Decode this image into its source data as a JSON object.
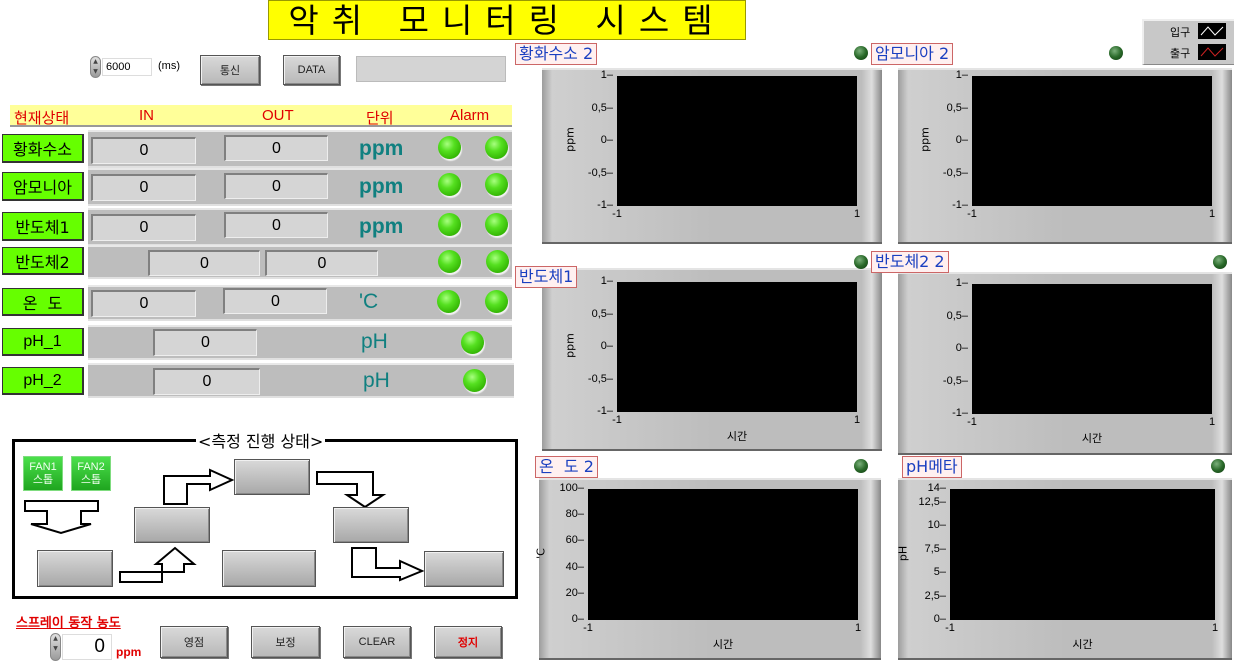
{
  "title": "악취 모니터링 시스템",
  "top_controls": {
    "interval_value": "6000",
    "interval_unit": "(ms)",
    "comm_button": "통신",
    "data_button": "DATA",
    "status_string": ""
  },
  "table": {
    "headers": [
      "현재상태",
      "IN",
      "OUT",
      "단위",
      "Alarm"
    ],
    "rows": [
      {
        "label": "황화수소",
        "in": "0",
        "out": "0",
        "unit": "ppm",
        "alarms": [
          "on",
          "on"
        ]
      },
      {
        "label": "암모니아",
        "in": "0",
        "out": "0",
        "unit": "ppm",
        "alarms": [
          "on",
          "on"
        ]
      },
      {
        "label": "반도체1",
        "in": "0",
        "out": "0",
        "unit": "ppm",
        "alarms": [
          "on",
          "on"
        ]
      },
      {
        "label": "반도체2",
        "in": "0",
        "out": "0",
        "unit": "",
        "alarms": [
          "on",
          "on"
        ]
      },
      {
        "label": "온  도",
        "in": "0",
        "out": "0",
        "unit": "'C",
        "alarms": [
          "on",
          "on"
        ]
      },
      {
        "label": "pH_1",
        "value": "0",
        "unit": "pH",
        "alarms": [
          "on"
        ]
      },
      {
        "label": "pH_2",
        "value": "0",
        "unit": "pH",
        "alarms": [
          "on"
        ]
      }
    ]
  },
  "progress": {
    "title": "<측정 진행 상태>",
    "fans": [
      {
        "line1": "FAN1",
        "line2": "스톱"
      },
      {
        "line1": "FAN2",
        "line2": "스톱"
      }
    ],
    "steps": [
      "",
      "",
      "",
      "",
      "",
      "",
      ""
    ]
  },
  "spray": {
    "label": "스프레이 동작 농도",
    "value": "0",
    "unit": "ppm"
  },
  "bottom_buttons": {
    "zero": "영점",
    "calibrate": "보정",
    "clear": "CLEAR",
    "stop": "정지"
  },
  "legend": {
    "items": [
      {
        "label": "입구",
        "color": "#ffffff"
      },
      {
        "label": "출구",
        "color": "#cc2222"
      }
    ]
  },
  "colors": {
    "title_bg": "#ffff00",
    "header_bg": "#ffff99",
    "header_text": "#e00000",
    "label_bg": "#66ff00",
    "unit_text": "#108080",
    "led_on": "#44dd11",
    "graph_title": "#1a3fc0"
  },
  "chart_data": [
    {
      "type": "line",
      "title": "황화수소 2",
      "ylabel": "ppm",
      "xlabel": "",
      "xlim": [
        -1,
        1
      ],
      "ylim": [
        -1,
        1
      ],
      "yticks": [
        "1",
        "0,5",
        "0",
        "-0,5",
        "-1"
      ],
      "xticks": [
        "-1",
        "1"
      ],
      "series": [
        {
          "name": "입구",
          "values": []
        },
        {
          "name": "출구",
          "values": []
        }
      ]
    },
    {
      "type": "line",
      "title": "암모니아 2",
      "ylabel": "ppm",
      "xlabel": "",
      "xlim": [
        -1,
        1
      ],
      "ylim": [
        -1,
        1
      ],
      "yticks": [
        "1",
        "0,5",
        "0",
        "-0,5",
        "-1"
      ],
      "xticks": [
        "-1",
        "1"
      ],
      "series": [
        {
          "name": "입구",
          "values": []
        },
        {
          "name": "출구",
          "values": []
        }
      ]
    },
    {
      "type": "line",
      "title": "반도체1",
      "ylabel": "ppm",
      "xlabel": "시간",
      "xlim": [
        -1,
        1
      ],
      "ylim": [
        -1,
        1
      ],
      "yticks": [
        "1",
        "0,5",
        "0",
        "-0,5",
        "-1"
      ],
      "xticks": [
        "-1",
        "1"
      ],
      "series": [
        {
          "name": "입구",
          "values": []
        },
        {
          "name": "출구",
          "values": []
        }
      ]
    },
    {
      "type": "line",
      "title": "반도체2 2",
      "ylabel": "",
      "xlabel": "시간",
      "xlim": [
        -1,
        1
      ],
      "ylim": [
        -1,
        1
      ],
      "yticks": [
        "1",
        "0,5",
        "0",
        "-0,5",
        "-1"
      ],
      "xticks": [
        "-1",
        "1"
      ],
      "series": [
        {
          "name": "입구",
          "values": []
        },
        {
          "name": "출구",
          "values": []
        }
      ]
    },
    {
      "type": "line",
      "title": "온  도 2",
      "ylabel": "'C",
      "xlabel": "시간",
      "xlim": [
        -1,
        1
      ],
      "ylim": [
        0,
        100
      ],
      "yticks": [
        "100",
        "80",
        "60",
        "40",
        "20",
        "0"
      ],
      "xticks": [
        "-1",
        "1"
      ],
      "series": [
        {
          "name": "입구",
          "values": []
        },
        {
          "name": "출구",
          "values": []
        }
      ]
    },
    {
      "type": "line",
      "title": "pH메타",
      "ylabel": "pH",
      "xlabel": "시간",
      "xlim": [
        -1,
        1
      ],
      "ylim": [
        0,
        14
      ],
      "yticks": [
        "14",
        "12,5",
        "10",
        "7,5",
        "5",
        "2,5",
        "0"
      ],
      "xticks": [
        "-1",
        "1"
      ],
      "series": [
        {
          "name": "입구",
          "values": []
        },
        {
          "name": "출구",
          "values": []
        }
      ]
    }
  ]
}
